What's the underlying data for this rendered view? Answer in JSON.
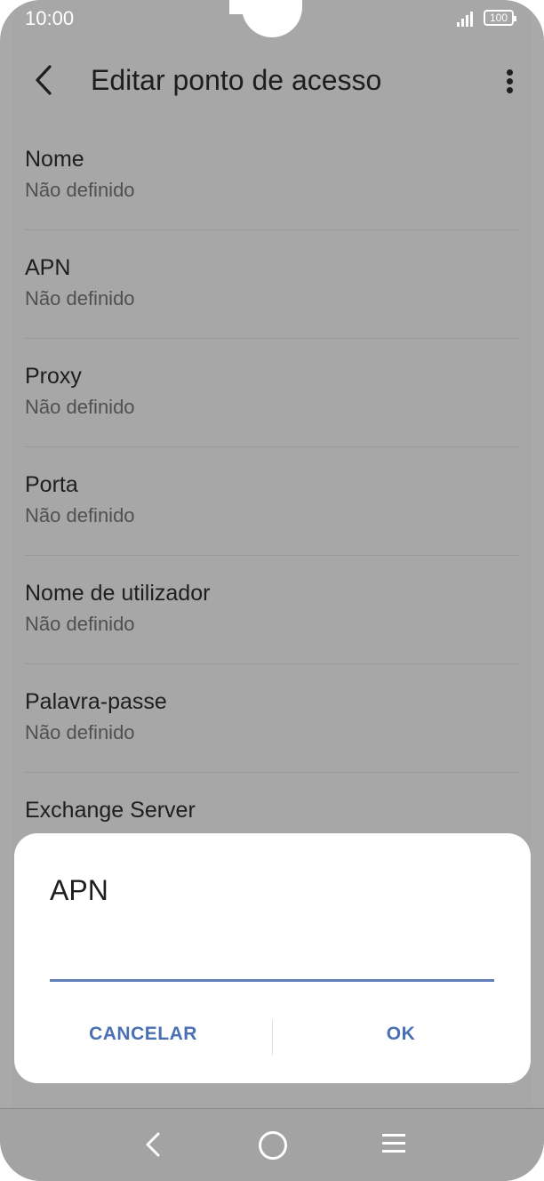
{
  "status_bar": {
    "time": "10:00",
    "battery": "100"
  },
  "header": {
    "title": "Editar ponto de acesso"
  },
  "settings_list": {
    "items": [
      {
        "label": "Nome",
        "value": "Não definido"
      },
      {
        "label": "APN",
        "value": "Não definido"
      },
      {
        "label": "Proxy",
        "value": "Não definido"
      },
      {
        "label": "Porta",
        "value": "Não definido"
      },
      {
        "label": "Nome de utilizador",
        "value": "Não definido"
      },
      {
        "label": "Palavra-passe",
        "value": "Não definido"
      },
      {
        "label": "Exchange Server",
        "value": ""
      }
    ]
  },
  "dialog": {
    "title": "APN",
    "input_value": "",
    "cancel_label": "CANCELAR",
    "ok_label": "OK"
  },
  "colors": {
    "accent": "#4a6fb5",
    "overlay": "#a7a7a7",
    "dialog_bg": "#ffffff"
  },
  "icons": {
    "back": "chevron-left-icon",
    "more": "vertical-dots-icon",
    "nav_back": "nav-back-icon",
    "nav_home": "nav-home-icon",
    "nav_recent": "nav-menu-icon"
  }
}
